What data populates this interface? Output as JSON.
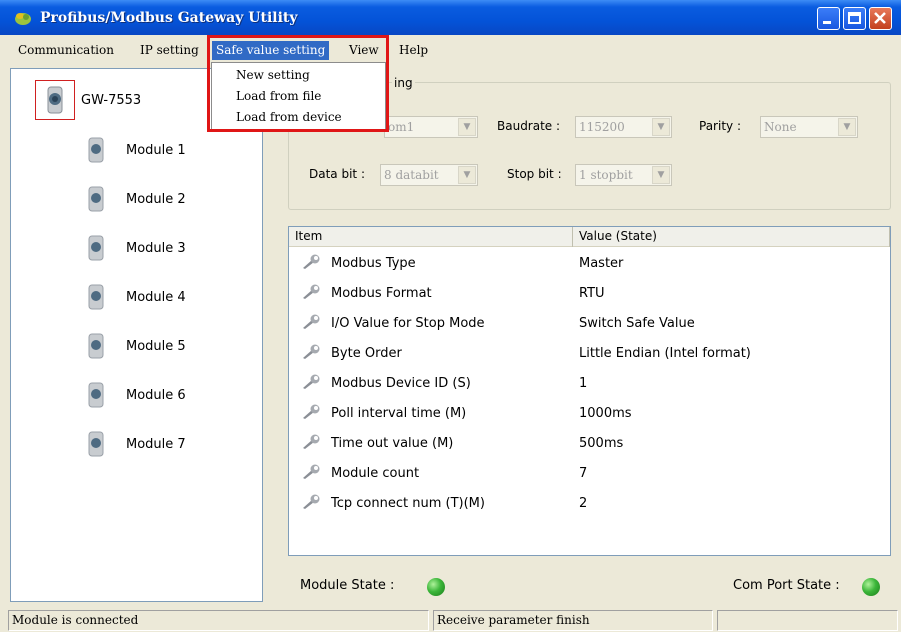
{
  "window": {
    "title": "Profibus/Modbus Gateway Utility"
  },
  "menu": {
    "items": [
      "Communication",
      "IP setting",
      "Safe value setting",
      "View",
      "Help"
    ],
    "dropdown": [
      "New setting",
      "Load from file",
      "Load from device"
    ]
  },
  "tree": {
    "root": "GW-7553",
    "modules": [
      "Module 1",
      "Module 2",
      "Module 3",
      "Module 4",
      "Module 5",
      "Module 6",
      "Module 7"
    ]
  },
  "comport": {
    "title_partial": "ing",
    "port_value": "om1",
    "baudrate_label": "Baudrate :",
    "baudrate_value": "115200",
    "parity_label": "Parity :",
    "parity_value": "None",
    "databit_label": "Data bit :",
    "databit_value": "8 databit",
    "stopbit_label": "Stop bit :",
    "stopbit_value": "1 stopbit"
  },
  "list": {
    "columns": [
      "Item",
      "Value (State)"
    ],
    "rows": [
      {
        "item": "Modbus Type",
        "value": "Master"
      },
      {
        "item": "Modbus Format",
        "value": "RTU"
      },
      {
        "item": "I/O Value for Stop Mode",
        "value": "Switch Safe Value"
      },
      {
        "item": "Byte Order",
        "value": "Little Endian (Intel format)"
      },
      {
        "item": "Modbus Device ID (S)",
        "value": "1"
      },
      {
        "item": "Poll interval time (M)",
        "value": "1000ms"
      },
      {
        "item": "Time out value (M)",
        "value": "500ms"
      },
      {
        "item": "Module count",
        "value": "7"
      },
      {
        "item": "Tcp connect num (T)(M)",
        "value": "2"
      }
    ]
  },
  "states": {
    "module_state_label": "Module  State :",
    "comport_state_label": "Com Port State :",
    "led_color": "#3cb63a"
  },
  "statusbar": {
    "left": "Module is connected",
    "middle": "Receive parameter finish",
    "right": ""
  },
  "colors": {
    "title_bar": "#0453d8",
    "menu_highlight": "#316ac5",
    "annotation_red": "#e01616"
  }
}
